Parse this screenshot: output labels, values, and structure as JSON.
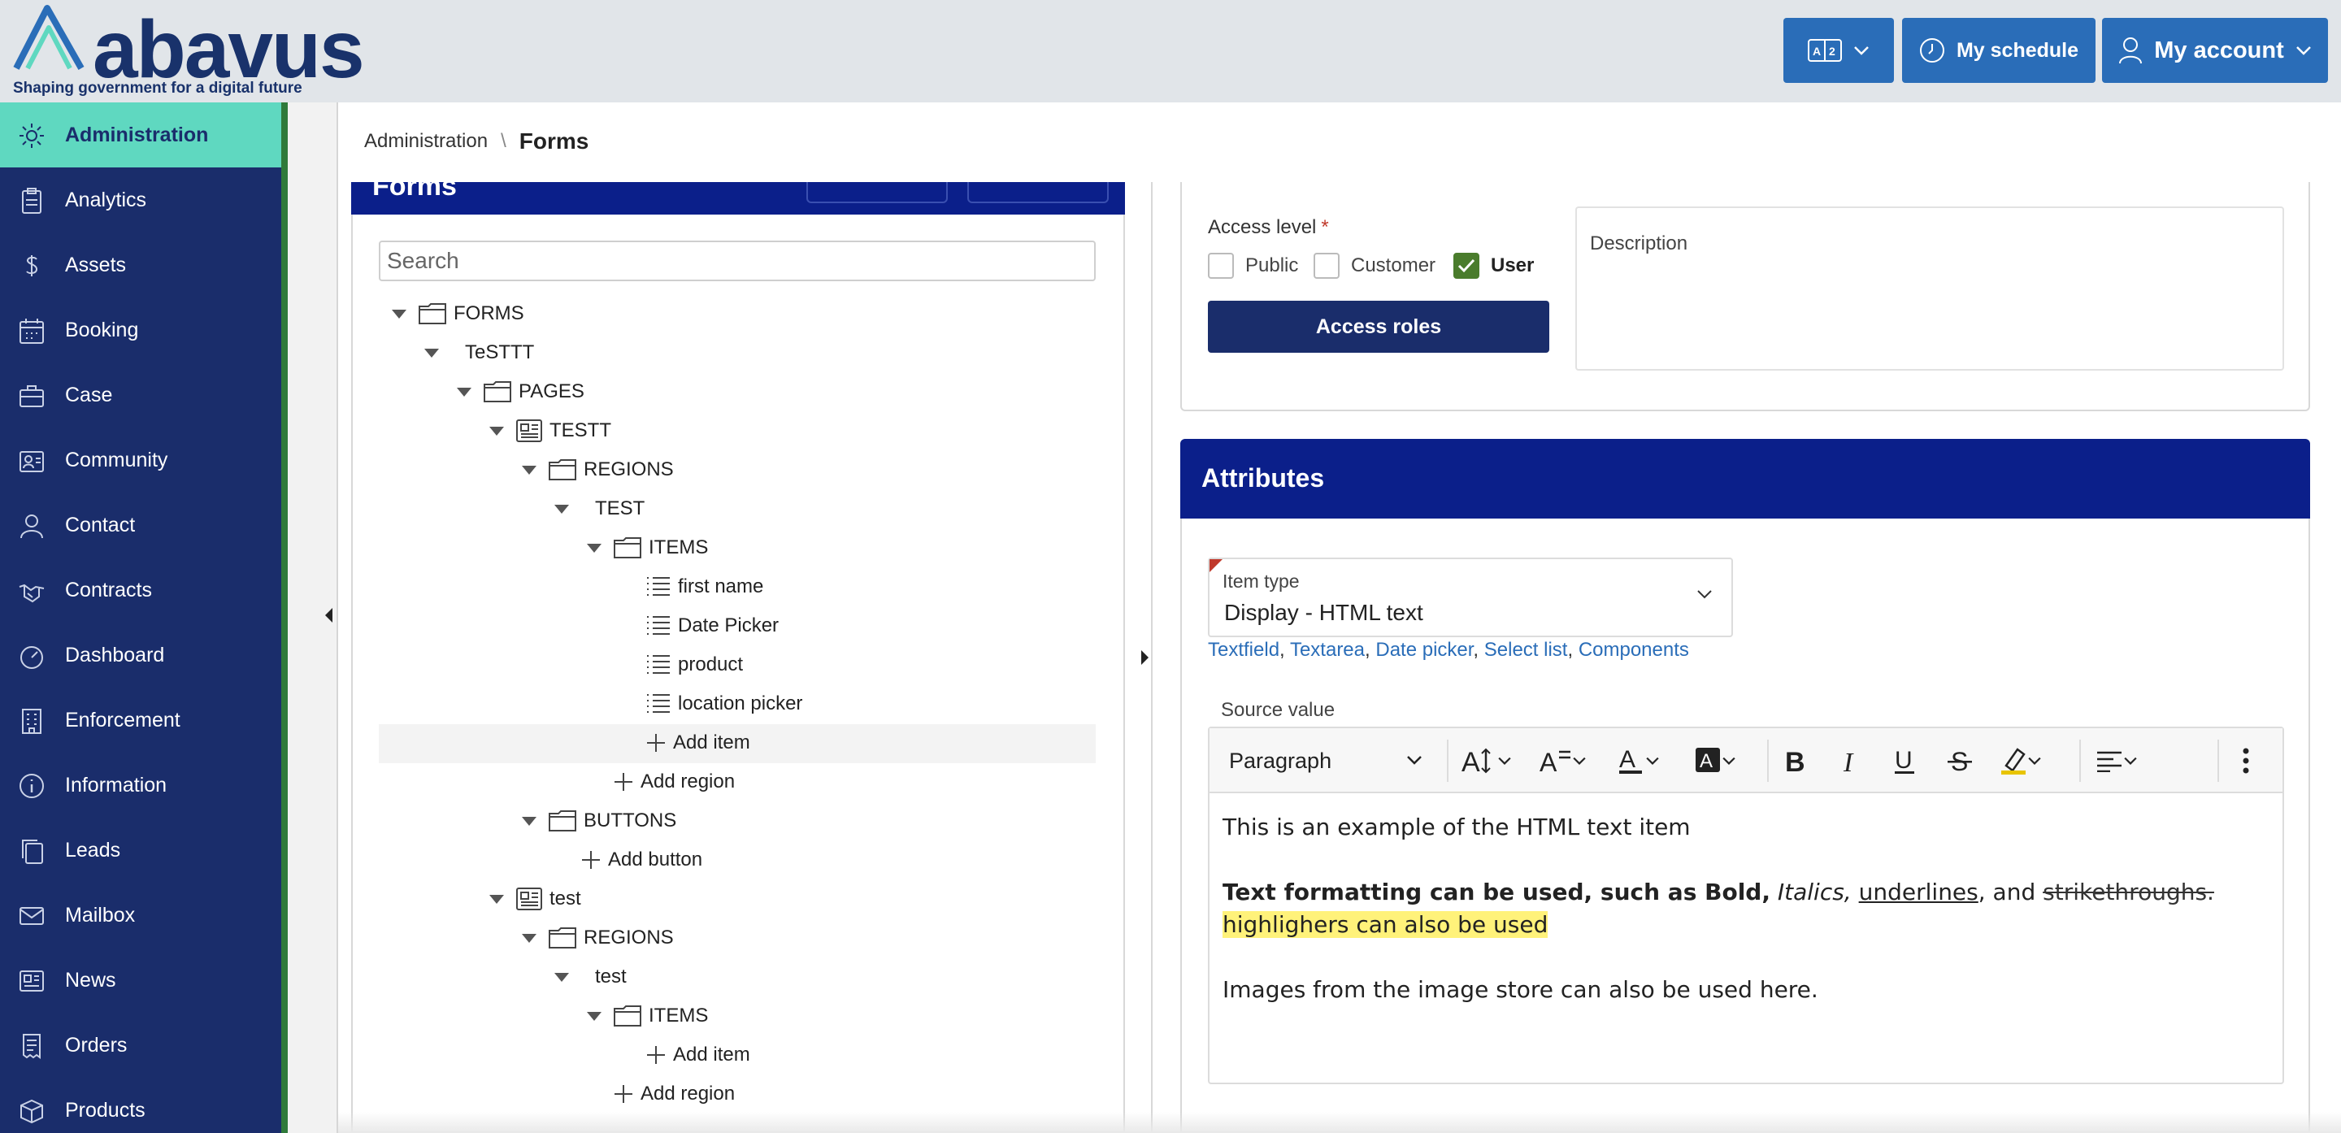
{
  "brand": {
    "name": "abavus",
    "tagline": "Shaping government for a digital future",
    "accent": "#2a6db8",
    "navy": "#1a2d6b",
    "panel_header": "#0b1f8a",
    "active_nav": "#5fd8c0"
  },
  "header": {
    "translate_icon": "translate-icon",
    "schedule_label": "My schedule",
    "account_label": "My account"
  },
  "sidebar": {
    "items": [
      {
        "label": "Administration",
        "icon": "gear-icon",
        "active": true
      },
      {
        "label": "Analytics",
        "icon": "clipboard-icon"
      },
      {
        "label": "Assets",
        "icon": "dollar-icon"
      },
      {
        "label": "Booking",
        "icon": "calendar-icon"
      },
      {
        "label": "Case",
        "icon": "briefcase-icon"
      },
      {
        "label": "Community",
        "icon": "id-card-icon"
      },
      {
        "label": "Contact",
        "icon": "user-icon"
      },
      {
        "label": "Contracts",
        "icon": "handshake-icon"
      },
      {
        "label": "Dashboard",
        "icon": "gauge-icon"
      },
      {
        "label": "Enforcement",
        "icon": "building-icon"
      },
      {
        "label": "Information",
        "icon": "info-icon"
      },
      {
        "label": "Leads",
        "icon": "copy-icon"
      },
      {
        "label": "Mailbox",
        "icon": "mail-icon"
      },
      {
        "label": "News",
        "icon": "newspaper-icon"
      },
      {
        "label": "Orders",
        "icon": "receipt-icon"
      },
      {
        "label": "Products",
        "icon": "box-icon"
      }
    ]
  },
  "breadcrumb": {
    "parent": "Administration",
    "separator": "\\",
    "current": "Forms"
  },
  "forms_panel": {
    "title": "Forms",
    "search_placeholder": "Search",
    "tree": [
      {
        "label": "FORMS",
        "kind": "folder",
        "expand": true
      },
      {
        "label": "TeSTTT",
        "kind": "plain",
        "expand": true
      },
      {
        "label": "PAGES",
        "kind": "folder",
        "expand": true
      },
      {
        "label": "TESTT",
        "kind": "page",
        "expand": true
      },
      {
        "label": "REGIONS",
        "kind": "folder",
        "expand": true
      },
      {
        "label": "TEST",
        "kind": "plain",
        "expand": true
      },
      {
        "label": "ITEMS",
        "kind": "folder",
        "expand": true
      },
      {
        "label": "first name",
        "kind": "list"
      },
      {
        "label": "Date Picker",
        "kind": "list"
      },
      {
        "label": "product",
        "kind": "list"
      },
      {
        "label": "location picker",
        "kind": "list"
      },
      {
        "label": "Add item",
        "kind": "add"
      },
      {
        "label": "Add region",
        "kind": "add"
      },
      {
        "label": "BUTTONS",
        "kind": "folder",
        "expand": true
      },
      {
        "label": "Add button",
        "kind": "add"
      },
      {
        "label": "test",
        "kind": "page",
        "expand": true
      },
      {
        "label": "REGIONS",
        "kind": "folder",
        "expand": true
      },
      {
        "label": "test",
        "kind": "plain",
        "expand": true
      },
      {
        "label": "ITEMS",
        "kind": "folder",
        "expand": true
      },
      {
        "label": "Add item",
        "kind": "add"
      },
      {
        "label": "Add region",
        "kind": "add"
      }
    ]
  },
  "access": {
    "label": "Access level",
    "required_mark": "*",
    "options": [
      {
        "label": "Public",
        "checked": false
      },
      {
        "label": "Customer",
        "checked": false
      },
      {
        "label": "User",
        "checked": true
      }
    ],
    "roles_button": "Access roles",
    "description_label": "Description"
  },
  "attributes": {
    "title": "Attributes",
    "item_type_label": "Item type",
    "item_type_value": "Display - HTML text",
    "type_links": [
      "Textfield",
      "Textarea",
      "Date picker",
      "Select list",
      "Components"
    ],
    "source_label": "Source value",
    "editor": {
      "block_format": "Paragraph",
      "line1": "This is an example of the HTML text item",
      "bold_part": "Text formatting can be used, such as Bold,",
      "italic_part": "Italics,",
      "underline_part": "underlines",
      "comma_and": ", and",
      "strike_part": "strikethroughs.",
      "highlight_part": "highlighers can also be used",
      "line3": "Images from the image store can also be used here."
    }
  }
}
